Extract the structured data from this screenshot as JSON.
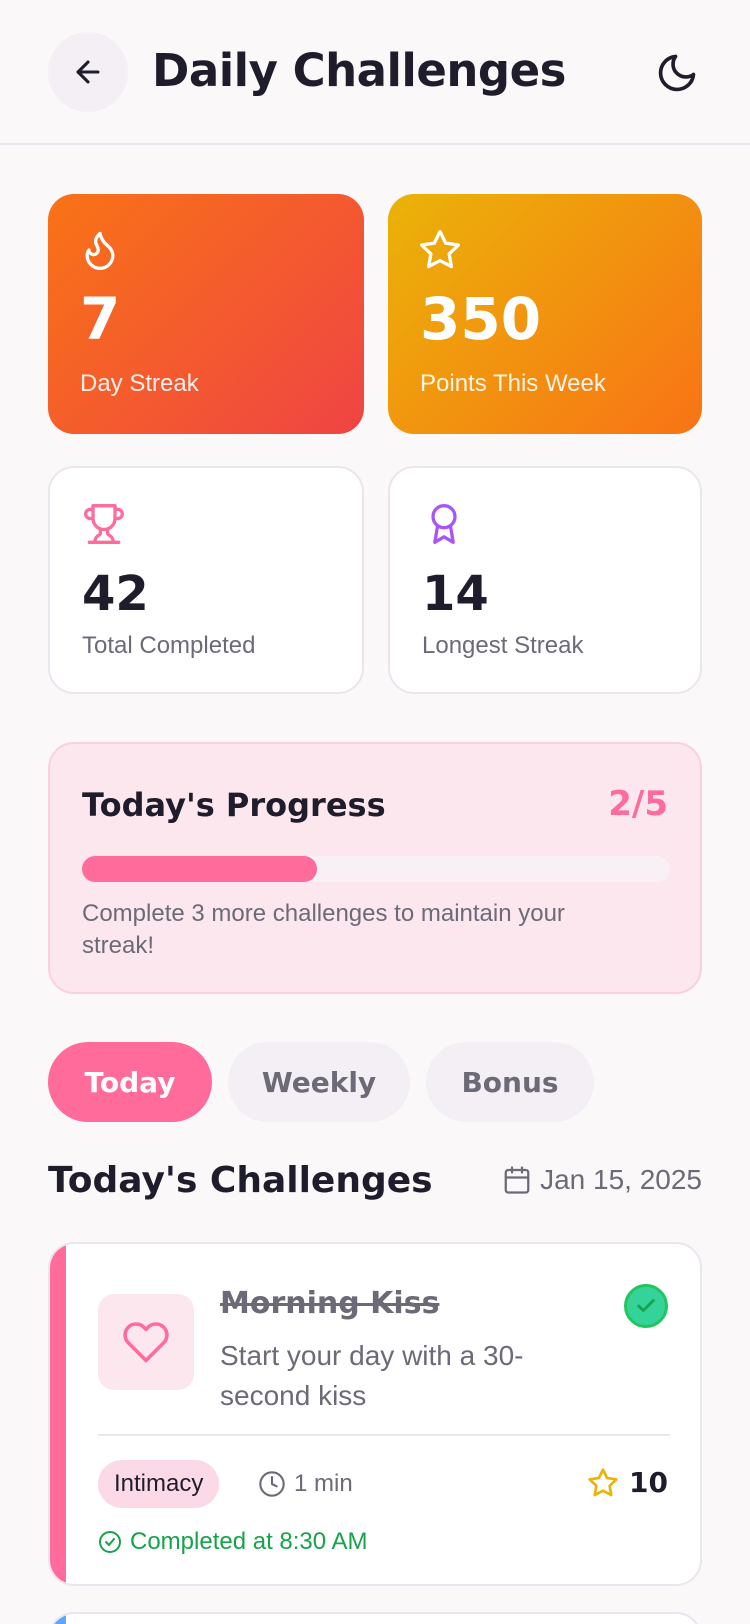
{
  "header": {
    "title": "Daily Challenges",
    "back_icon": "arrow-left-icon",
    "theme_icon": "moon-icon"
  },
  "stats": [
    {
      "value": "7",
      "label": "Day Streak",
      "icon": "flame-icon"
    },
    {
      "value": "350",
      "label": "Points This Week",
      "icon": "star-icon"
    },
    {
      "value": "42",
      "label": "Total Completed",
      "icon": "trophy-icon"
    },
    {
      "value": "14",
      "label": "Longest Streak",
      "icon": "award-icon"
    }
  ],
  "progress": {
    "title": "Today's Progress",
    "count": "2/5",
    "fraction": 0.4,
    "note": "Complete 3 more challenges to maintain your streak!"
  },
  "tabs": [
    {
      "label": "Today",
      "active": true
    },
    {
      "label": "Weekly",
      "active": false
    },
    {
      "label": "Bonus",
      "active": false
    }
  ],
  "section": {
    "title": "Today's Challenges",
    "date": "Jan 15, 2025"
  },
  "challenges": [
    {
      "title": "Morning Kiss",
      "description": "Start your day with a 30-second kiss",
      "category": "Intimacy",
      "duration": "1 min",
      "points": "10",
      "completed_text": "Completed at 8:30 AM",
      "icon": "heart-icon"
    }
  ],
  "colors": {
    "accent": "#ff6b9a",
    "success": "#22c55e",
    "text": "#1f1d2b",
    "muted": "#6d6a77"
  }
}
